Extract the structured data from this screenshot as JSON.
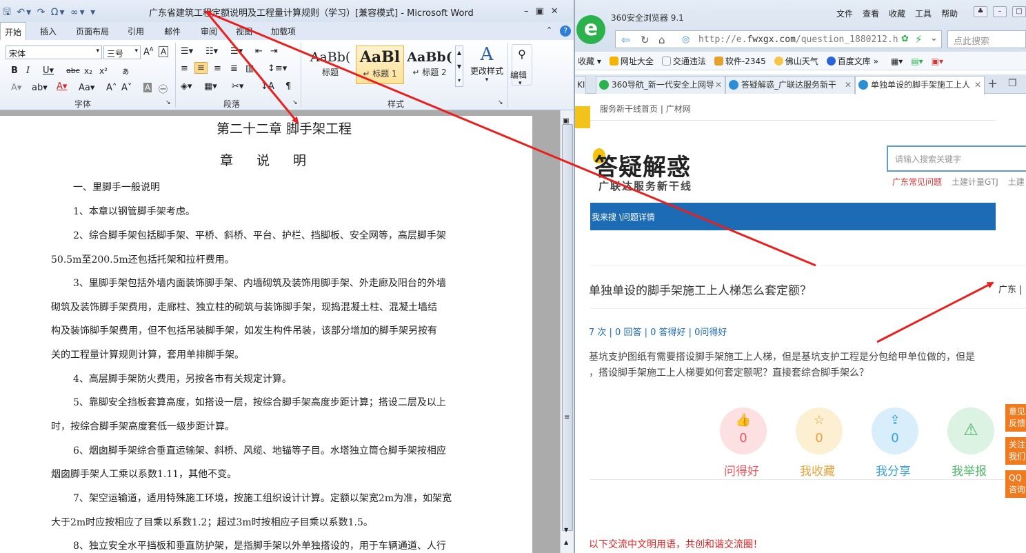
{
  "word": {
    "window_title": "广东省建筑工程定额说明及工程量计算规则（学习）[兼容模式] - Microsoft Word",
    "tabs": [
      "开始",
      "插入",
      "页面布局",
      "引用",
      "邮件",
      "审阅",
      "视图",
      "加载项"
    ],
    "font_name": "宋体",
    "font_size": "三号",
    "styles": [
      {
        "sample": "AaBb(",
        "name": "标题"
      },
      {
        "sample": "AaBl",
        "name": "↵ 标题 1"
      },
      {
        "sample": "AaBb(",
        "name": "↵ 标题 2"
      }
    ],
    "change_styles_label": "更改样式",
    "edit_label": "编辑",
    "group_labels": {
      "font": "字体",
      "paragraph": "段落",
      "styles": "样式"
    },
    "document": {
      "chapter_title": "第二十二章  脚手架工程",
      "section_title": "章说明",
      "lines": [
        "一、里脚手一般说明",
        "1、本章以钢管脚手架考虑。",
        "2、综合脚手架包括脚手架、平桥、斜桥、平台、护栏、挡脚板、安全网等，高层脚手架",
        "50.5m至200.5m还包括托架和拉杆费用。",
        "3、里脚手架包括外墙内面装饰脚手架、内墙砌筑及装饰用脚手架、外走廊及阳台的外墙",
        "砌筑及装饰脚手架费用，走廊柱、独立柱的砌筑与装饰脚手架，现捣混凝土柱、混凝土墙结",
        "构及装饰脚手架费用，但不包括吊装脚手架，如发生构件吊装，该部分增加的脚手架另按有",
        "关的工程量计算规则计算，套用单排脚手架。",
        "4、高层脚手架防火费用，另按各市有关规定计算。",
        "5、靠脚安全挡板套算高度，如搭设一层，按综合脚手架高度步距计算；搭设二层及以上",
        "时，按综合脚手架高度套低一级步距计算。",
        "6、烟囱脚手架综合垂直运输架、斜桥、风缆、地锚等子目。水塔独立筒仓脚手架按相应",
        "烟囱脚手架人工乘以系数1.11，其他不变。",
        "7、架空运输道，适用特殊施工环境，按施工组织设计计算。定额以架宽2m为准，如架宽",
        "大于2m时应按相应了目乘以系数1.2；超过3m时按相应子目乘以系数1.5。",
        "8、独立安全水平挡板和垂直防护架，是指脚手架以外单独搭设的，用于车辆通道、人行"
      ]
    }
  },
  "browser": {
    "app_name": "360安全浏览器 9.1",
    "menu": [
      "文件",
      "查看",
      "收藏",
      "工具",
      "帮助"
    ],
    "url_prefix": "http://e.",
    "url_domain": "fwxgx.com",
    "url_path": "/question_1880212.h",
    "search_placeholder": "点此搜索",
    "bookmarks": [
      "收藏",
      "网址大全",
      "交通违法",
      "软件-2345",
      "佛山天气",
      "百度文库"
    ],
    "tabs": [
      {
        "label": "360导航_新一代安全上网导",
        "active": false
      },
      {
        "label": "答疑解惑_广联达服务新干",
        "active": false
      },
      {
        "label": "单独单设的脚手架施工上人",
        "active": true
      }
    ],
    "page": {
      "crumb": "服务新干线首页  |   广材网",
      "logo_title": "答疑解惑",
      "logo_sub": "广联达服务新干线",
      "search_placeholder": "请输入搜索关键字",
      "quick_links": [
        "广东常见问题",
        "土建计量GTJ",
        "土建"
      ],
      "nav_crumb": "我来搜 \\问题详情",
      "question_title": "单独单设的脚手架施工上人梯怎么套定额？",
      "region": "广东 |",
      "stats": "7 次 | 0 回答 | 0 答得好 | 0问得好",
      "body_line1": "基坑支护图纸有需要搭设脚手架施工上人梯，但是基坑支护工程是分包给甲单位做的，但是",
      "body_line2": "，搭设脚手架施工上人梯要如何套定额呢？直接套综合脚手架么？",
      "actions": [
        {
          "label": "问得好",
          "count": "0",
          "color": "#e8575f",
          "bg": "#fde0e2",
          "icon": "thumb-up"
        },
        {
          "label": "我收藏",
          "count": "0",
          "color": "#e8a23a",
          "bg": "#fdefd2",
          "icon": "star"
        },
        {
          "label": "我分享",
          "count": "0",
          "color": "#3ba0d9",
          "bg": "#d8eefa",
          "icon": "share"
        },
        {
          "label": "我举报",
          "count": "",
          "color": "#4fb66a",
          "bg": "#dcf2e2",
          "icon": "warning"
        }
      ],
      "side_buttons": [
        "意见\n反馈",
        "关注\n我们",
        "QQ\n咨询"
      ],
      "civil_notice": "以下交流中文明用语，共创和谐交流圈！"
    }
  },
  "annotation_color": "#e8201e"
}
